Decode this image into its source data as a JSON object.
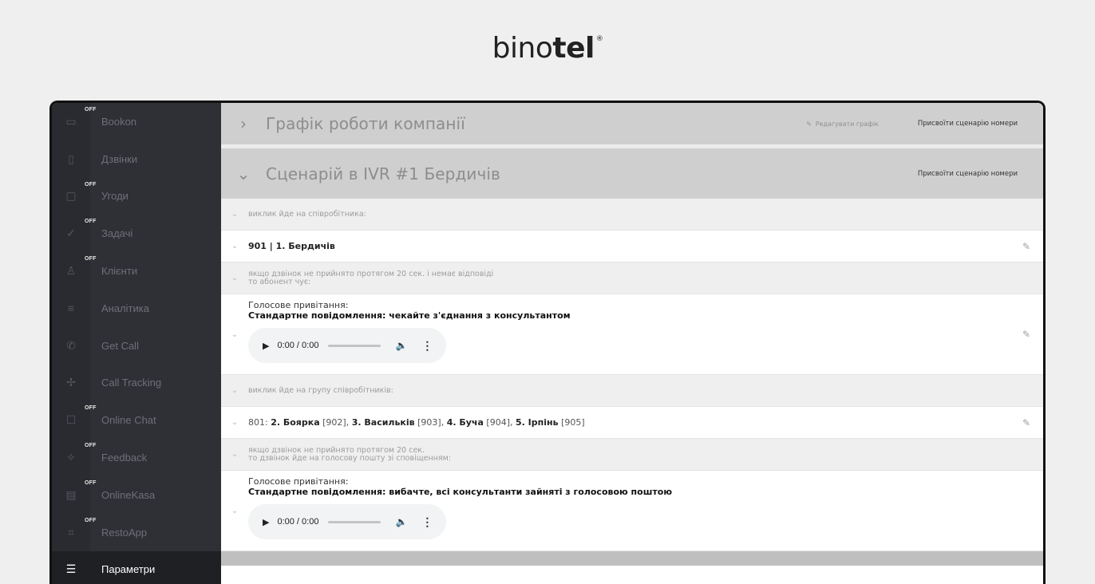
{
  "brand": {
    "light": "bino",
    "bold": "tel",
    "reg": "®"
  },
  "sidebar": {
    "items": [
      {
        "label": "Bookon",
        "icon": "▭",
        "icon_name": "calendar-check-icon",
        "off": "OFF"
      },
      {
        "label": "Дзвінки",
        "icon": "▯",
        "icon_name": "phone-log-icon",
        "off": ""
      },
      {
        "label": "Угоди",
        "icon": "▢",
        "icon_name": "deals-icon",
        "off": "OFF"
      },
      {
        "label": "Задачі",
        "icon": "✓",
        "icon_name": "check-icon",
        "off": "OFF"
      },
      {
        "label": "Клієнти",
        "icon": "♙",
        "icon_name": "user-icon",
        "off": "OFF"
      },
      {
        "label": "Аналітика",
        "icon": "≡",
        "icon_name": "analytics-icon",
        "off": ""
      },
      {
        "label": "Get Call",
        "icon": "✆",
        "icon_name": "get-call-icon",
        "off": ""
      },
      {
        "label": "Call Tracking",
        "icon": "✢",
        "icon_name": "call-tracking-icon",
        "off": ""
      },
      {
        "label": "Online Chat",
        "icon": "☐",
        "icon_name": "chat-icon",
        "off": "OFF"
      },
      {
        "label": "Feedback",
        "icon": "✧",
        "icon_name": "feedback-icon",
        "off": "OFF"
      },
      {
        "label": "OnlineKasa",
        "icon": "▤",
        "icon_name": "cash-register-icon",
        "off": "OFF"
      },
      {
        "label": "RestoApp",
        "icon": "⌗",
        "icon_name": "resto-icon",
        "off": "OFF"
      },
      {
        "label": "Параметри",
        "icon": "☰",
        "icon_name": "settings-sliders-icon",
        "off": "",
        "active": true
      }
    ]
  },
  "header1": {
    "chevron": "›",
    "title": "Графік роботи компанії",
    "edit_label": "Редагувати графік",
    "assign_label": "Присвоїти сценарію номери"
  },
  "header2": {
    "chevron": "⌄",
    "title": "Сценарій в IVR #1 Бердичів",
    "assign_label": "Присвоїти сценарію номери"
  },
  "rows": {
    "note1": "виклик йде на співробітника:",
    "entry1": {
      "prefix": "901 | 1. Бердичів"
    },
    "note2_line1": "якщо дзвінок не прийнято протягом 20 сек. і немає відповіді",
    "note2_line2": "то абонент чує:",
    "greet1": {
      "label": "Голосове привітання:",
      "message": "Стандартне повідомлення: чекайте з'єднання з консультантом"
    },
    "note3": "виклик йде на групу співробітників:",
    "entry2": {
      "num": "801:",
      "a_name": "2. Боярка",
      "a_ext": "[902],",
      "b_name": "3. Васильків",
      "b_ext": "[903],",
      "c_name": "4. Буча",
      "c_ext": "[904],",
      "d_name": "5. Ірпінь",
      "d_ext": "[905]"
    },
    "note4_line1": "якщо дзвінок не прийнято протягом 20 сек.",
    "note4_line2": "то дзвінок йде на голосову пошту зі сповіщенням:",
    "greet2": {
      "label": "Голосове привітання:",
      "message": "Стандартне повідомлення: вибачте, всі консультанти зайняті з голосовою поштою"
    }
  },
  "player": {
    "time": "0:00 / 0:00",
    "play_icon": "▶",
    "volume_icon": "🔈",
    "more_icon": "⋮"
  }
}
